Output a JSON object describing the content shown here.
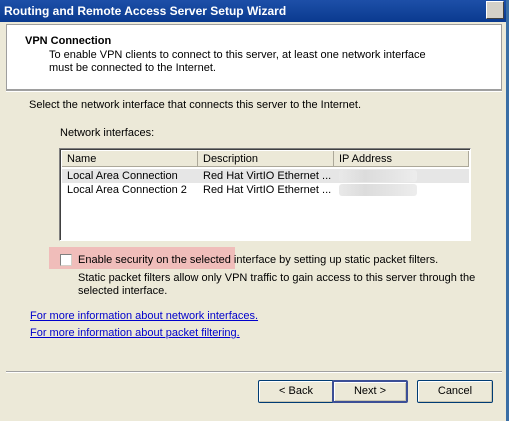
{
  "window": {
    "title": "Routing and Remote Access Server Setup Wizard"
  },
  "header": {
    "title": "VPN Connection",
    "description": "To enable VPN clients to connect to this server, at least one network interface must be connected to the Internet."
  },
  "instruction": "Select the network interface that connects this server to the Internet.",
  "network_interfaces": {
    "label": "Network interfaces:",
    "columns": [
      "Name",
      "Description",
      "IP Address"
    ],
    "rows": [
      {
        "name": "Local Area Connection",
        "description": "Red Hat VirtIO Ethernet ...",
        "ip": ""
      },
      {
        "name": "Local Area Connection 2",
        "description": "Red Hat VirtIO Ethernet ...",
        "ip": ""
      }
    ]
  },
  "security": {
    "checkbox_label": "Enable security on the selected interface by setting up static packet filters.",
    "checked": false,
    "description": "Static packet filters allow only VPN traffic to gain access to this server through the selected interface."
  },
  "links": {
    "network_interfaces": "For more information about network interfaces.",
    "packet_filtering": "For more information about packet filtering."
  },
  "buttons": {
    "back": "< Back",
    "next": "Next >",
    "cancel": "Cancel"
  },
  "colors": {
    "titlebar": "#0a3a8f",
    "highlight": "#f1b5b5",
    "link": "#0000cc"
  }
}
